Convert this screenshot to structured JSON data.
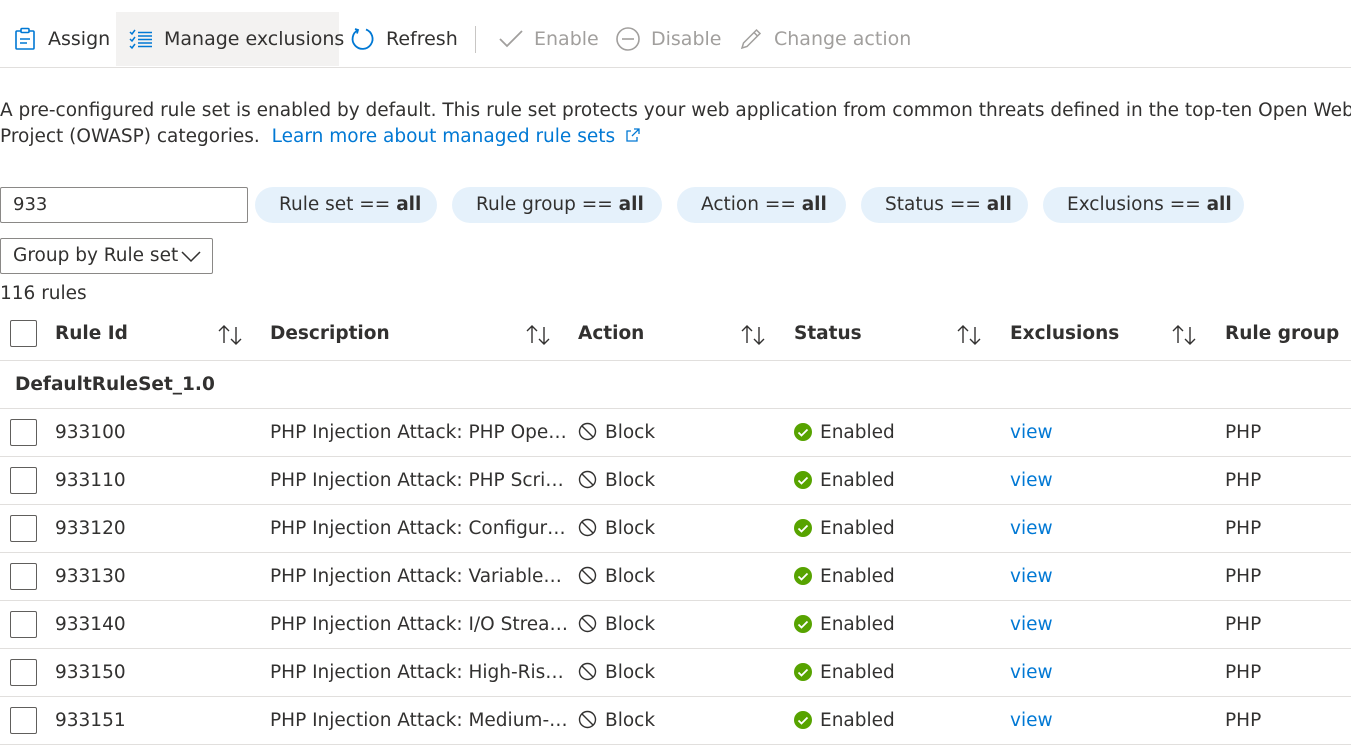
{
  "toolbar": {
    "assign": "Assign",
    "manage_exclusions": "Manage exclusions",
    "refresh": "Refresh",
    "enable": "Enable",
    "disable": "Disable",
    "change_action": "Change action"
  },
  "info": {
    "text": "A pre-configured rule set is enabled by default. This rule set protects your web application from common threats defined in the top-ten Open Web Application Security",
    "text2": "Project (OWASP) categories.",
    "link": "Learn more about managed rule sets"
  },
  "filters": {
    "search_value": "933",
    "pills": [
      {
        "label": "Rule set == ",
        "value": "all"
      },
      {
        "label": "Rule group == ",
        "value": "all"
      },
      {
        "label": "Action == ",
        "value": "all"
      },
      {
        "label": "Status == ",
        "value": "all"
      },
      {
        "label": "Exclusions == ",
        "value": "all"
      }
    ],
    "group_by": "Group by Rule set"
  },
  "count": "116 rules",
  "table": {
    "columns": {
      "rule_id": "Rule Id",
      "description": "Description",
      "action": "Action",
      "status": "Status",
      "exclusions": "Exclusions",
      "rule_group": "Rule group"
    },
    "group_name": "DefaultRuleSet_1.0",
    "rows": [
      {
        "id": "933100",
        "desc": "PHP Injection Attack: PHP Open ...",
        "action": "Block",
        "status": "Enabled",
        "exclusions": "view",
        "group": "PHP"
      },
      {
        "id": "933110",
        "desc": "PHP Injection Attack: PHP Script...",
        "action": "Block",
        "status": "Enabled",
        "exclusions": "view",
        "group": "PHP"
      },
      {
        "id": "933120",
        "desc": "PHP Injection Attack: Configurat...",
        "action": "Block",
        "status": "Enabled",
        "exclusions": "view",
        "group": "PHP"
      },
      {
        "id": "933130",
        "desc": "PHP Injection Attack: Variables F...",
        "action": "Block",
        "status": "Enabled",
        "exclusions": "view",
        "group": "PHP"
      },
      {
        "id": "933140",
        "desc": "PHP Injection Attack: I/O Stream...",
        "action": "Block",
        "status": "Enabled",
        "exclusions": "view",
        "group": "PHP"
      },
      {
        "id": "933150",
        "desc": "PHP Injection Attack: High-Risk ...",
        "action": "Block",
        "status": "Enabled",
        "exclusions": "view",
        "group": "PHP"
      },
      {
        "id": "933151",
        "desc": "PHP Injection Attack: Medium-R...",
        "action": "Block",
        "status": "Enabled",
        "exclusions": "view",
        "group": "PHP"
      }
    ]
  },
  "colors": {
    "accent": "#0078d4",
    "enabled_green": "#57a300",
    "pill_bg": "#e5f1fb"
  }
}
